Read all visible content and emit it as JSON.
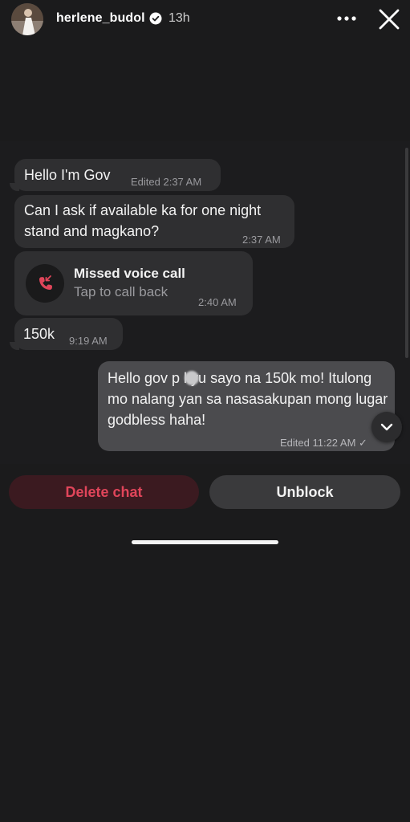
{
  "header": {
    "username": "herlene_budol",
    "time_ago": "13h",
    "verified_icon": "verified-badge-icon",
    "more_icon": "more-horizontal-icon",
    "close_icon": "close-icon"
  },
  "messages": [
    {
      "text": "Hello I'm Gov",
      "meta": "Edited 2:37 AM",
      "direction": "incoming"
    },
    {
      "text": "Can I ask if available ka for one night stand and magkano?",
      "meta": "2:37 AM",
      "direction": "incoming"
    },
    {
      "type": "call",
      "title": "Missed voice call",
      "subtitle": "Tap to call back",
      "meta": "2:40 AM",
      "icon": "missed-call-icon",
      "direction": "incoming"
    },
    {
      "text": "150k",
      "meta": "9:19 AM",
      "direction": "incoming"
    },
    {
      "text": "Hello gov p  kyu sayo na 150k mo! Itulong mo nalang yan sa nasasakupan mong lugar godbless haha!",
      "meta": "Edited 11:22 AM ✓",
      "direction": "outgoing"
    }
  ],
  "actions": {
    "delete_label": "Delete chat",
    "unblock_label": "Unblock"
  },
  "colors": {
    "background": "#1b1b1c",
    "incoming_bubble": "#2f2f31",
    "outgoing_bubble": "#4b4b4e",
    "delete_text": "#e0455a",
    "missed_call_red": "#e0455a"
  }
}
